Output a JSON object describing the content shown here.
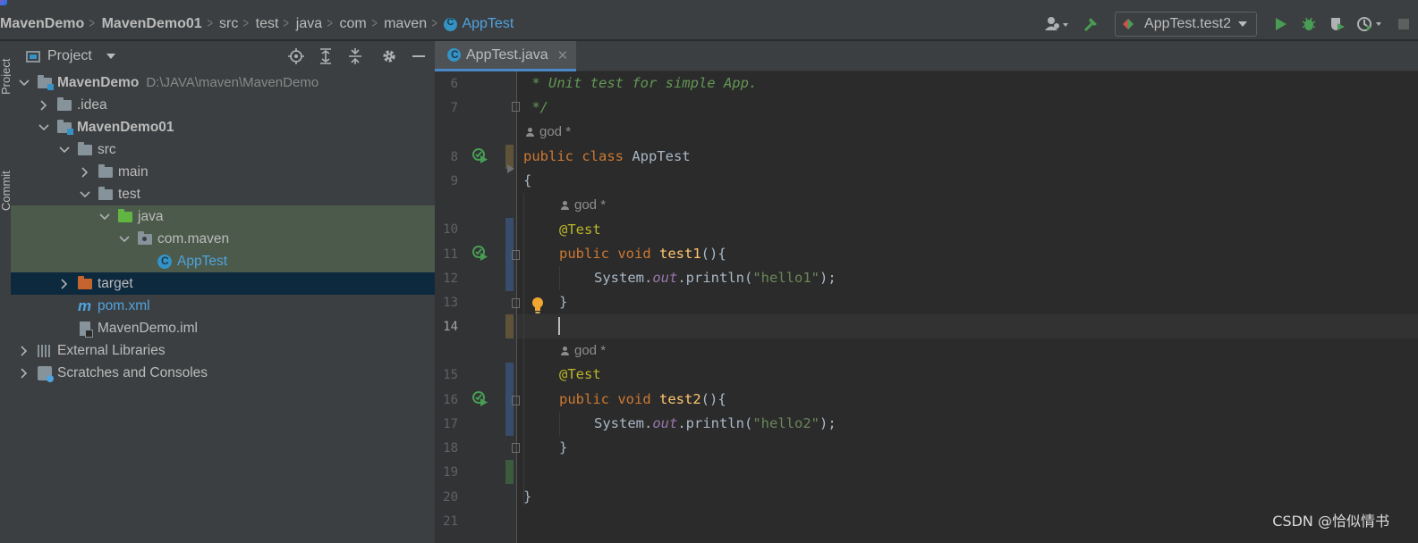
{
  "breadcrumbs": [
    "MavenDemo",
    "MavenDemo01",
    "src",
    "test",
    "java",
    "com",
    "maven",
    "AppTest"
  ],
  "run_config": {
    "label": "AppTest.test2"
  },
  "project_panel": {
    "title": "Project",
    "tree": [
      {
        "label": "MavenDemo",
        "path": "D:\\JAVA\\maven\\MavenDemo"
      },
      {
        "label": ".idea"
      },
      {
        "label": "MavenDemo01"
      },
      {
        "label": "src"
      },
      {
        "label": "main"
      },
      {
        "label": "test"
      },
      {
        "label": "java"
      },
      {
        "label": "com.maven"
      },
      {
        "label": "AppTest"
      },
      {
        "label": "target"
      },
      {
        "label": "pom.xml"
      },
      {
        "label": "MavenDemo.iml"
      },
      {
        "label": "External Libraries"
      },
      {
        "label": "Scratches and Consoles"
      }
    ]
  },
  "left_stripe": {
    "project": "Project",
    "commit": "Commit"
  },
  "editor": {
    "tab_label": "AppTest.java",
    "current_line": 14,
    "line_numbers": [
      "6",
      "7",
      "8",
      "9",
      "10",
      "11",
      "12",
      "13",
      "14",
      "15",
      "16",
      "17",
      "18",
      "19",
      "20",
      "21"
    ],
    "author_hint": "god *",
    "code": {
      "l6": " * Unit test for simple App.",
      "l7": " */",
      "l8_kw": "public class",
      "l8_name": " AppTest",
      "l9": "{",
      "l10": "@Test",
      "l11_kw": "public void",
      "l11_fn": "test1",
      "l11_rest": "(){",
      "l12_a": "System.",
      "l12_out": "out",
      "l12_b": ".println(",
      "l12_str": "\"hello1\"",
      "l12_c": ");",
      "l13": "}",
      "l15": "@Test",
      "l16_kw": "public void",
      "l16_fn": "test2",
      "l16_rest": "(){",
      "l17_a": "System.",
      "l17_out": "out",
      "l17_b": ".println(",
      "l17_str": "\"hello2\"",
      "l17_c": ");",
      "l18": "}",
      "l20": "}"
    }
  },
  "watermark": "CSDN @恰似情书",
  "colors": {
    "keyword": "#cc7832",
    "annotation": "#bbb529",
    "method": "#ffc66d",
    "string": "#6a8759",
    "comment": "#629755",
    "selection": "#0d293e",
    "test_highlight": "#4b5a4a"
  }
}
